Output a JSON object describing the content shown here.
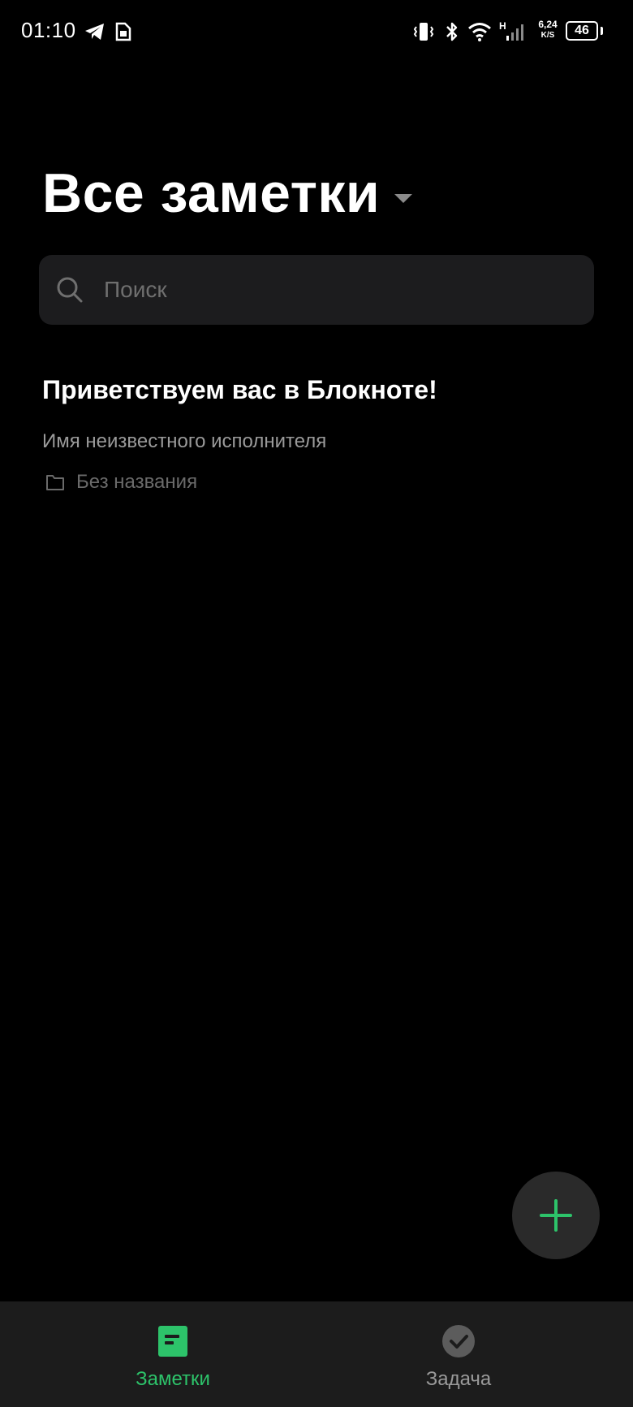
{
  "status_bar": {
    "time": "01:10",
    "network_type": "H",
    "speed_value": "6,24",
    "speed_unit": "K/S",
    "battery_level": "46",
    "battery_percent": 0.46,
    "icons": [
      "telegram-icon",
      "sim-icon",
      "vibrate-icon",
      "bluetooth-icon",
      "wifi-icon",
      "signal-icon",
      "battery-icon"
    ]
  },
  "header": {
    "title": "Все заметки"
  },
  "search": {
    "placeholder": "Поиск"
  },
  "notes": [
    {
      "title": "Приветствуем вас в Блокноте!",
      "snippet": "Имя неизвестного исполнителя",
      "folder": "Без названия"
    }
  ],
  "bottom_nav": {
    "tabs": [
      {
        "label": "Заметки",
        "icon": "notes-icon",
        "active": true
      },
      {
        "label": "Задача",
        "icon": "task-check-icon",
        "active": false
      }
    ]
  },
  "colors": {
    "background": "#000000",
    "accent": "#2dc36a",
    "surface": "#1c1c1e",
    "fab": "#2a2a2a",
    "muted_text": "#9a9a9a"
  }
}
